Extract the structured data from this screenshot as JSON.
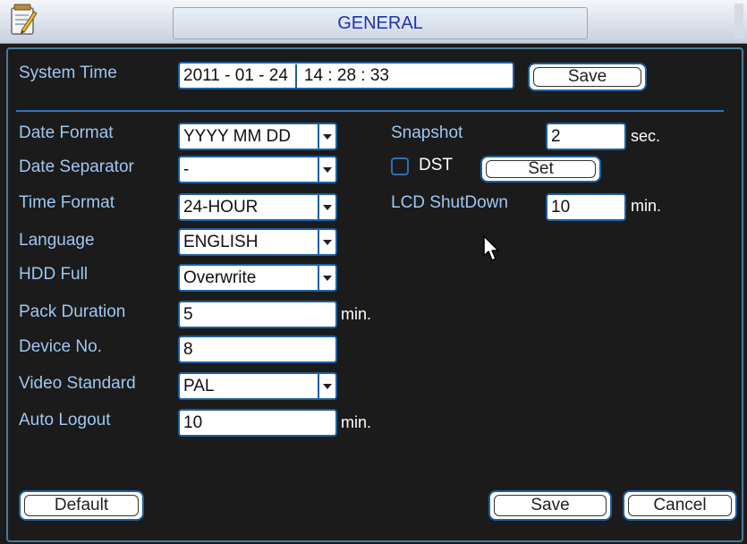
{
  "window": {
    "title": "GENERAL"
  },
  "system_time": {
    "label": "System Time",
    "date": "2011  - 01 - 24",
    "time": "14 : 28 : 33",
    "save_label": "Save"
  },
  "fields": {
    "date_format": {
      "label": "Date Format",
      "value": "YYYY MM DD"
    },
    "date_separator": {
      "label": "Date Separator",
      "value": "-"
    },
    "time_format": {
      "label": "Time Format",
      "value": "24-HOUR"
    },
    "language": {
      "label": "Language",
      "value": "ENGLISH"
    },
    "hdd_full": {
      "label": "HDD Full",
      "value": "Overwrite"
    },
    "pack_duration": {
      "label": "Pack Duration",
      "value": "5",
      "unit": "min."
    },
    "device_no": {
      "label": "Device No.",
      "value": "8"
    },
    "video_standard": {
      "label": "Video Standard",
      "value": "PAL"
    },
    "auto_logout": {
      "label": "Auto Logout",
      "value": "10",
      "unit": "min."
    }
  },
  "right": {
    "snapshot": {
      "label": "Snapshot",
      "value": "2",
      "unit": "sec."
    },
    "dst": {
      "label": "DST",
      "checked": false,
      "set_label": "Set"
    },
    "lcd_shutdown": {
      "label": "LCD ShutDown",
      "value": "10",
      "unit": "min."
    }
  },
  "footer": {
    "default_label": "Default",
    "save_label": "Save",
    "cancel_label": "Cancel"
  },
  "colors": {
    "label": "#9fc7f2",
    "title_text": "#1f33b0",
    "border": "#1d5fa3",
    "background": "#1b1b1b"
  },
  "icons": {
    "app": "notepad-icon",
    "cursor": "mouse-pointer-icon"
  }
}
